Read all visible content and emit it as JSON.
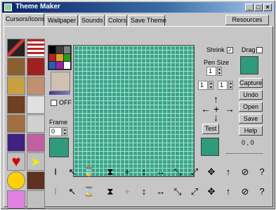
{
  "window": {
    "title": "Theme Maker"
  },
  "tabs": [
    "Cursors/Icons",
    "Wallpaper",
    "Sounds",
    "Colors",
    "Save Theme"
  ],
  "resources_label": "Resources",
  "palette": [
    "#000000",
    "#404040",
    "#808080",
    "#c02020",
    "#e0a020",
    "#20a020",
    "#2060c0",
    "#a020a0",
    "#ffffff"
  ],
  "off_label": "OFF",
  "frame": {
    "label": "Frame",
    "value": "0"
  },
  "shrink_label": "Shrink",
  "drag_label": "Drag",
  "pen_size": {
    "label": "Pen Size",
    "value": "1"
  },
  "coord_x": "1",
  "coord_y": "1",
  "test_label": "Test",
  "buttons": {
    "capture": "Capture",
    "undo": "Undo",
    "open": "Open",
    "save": "Save",
    "help": "Help"
  },
  "pos_readout": "0 , 0",
  "colors": {
    "grid_fill": "#3aa58a",
    "accent": "#0a246a"
  }
}
